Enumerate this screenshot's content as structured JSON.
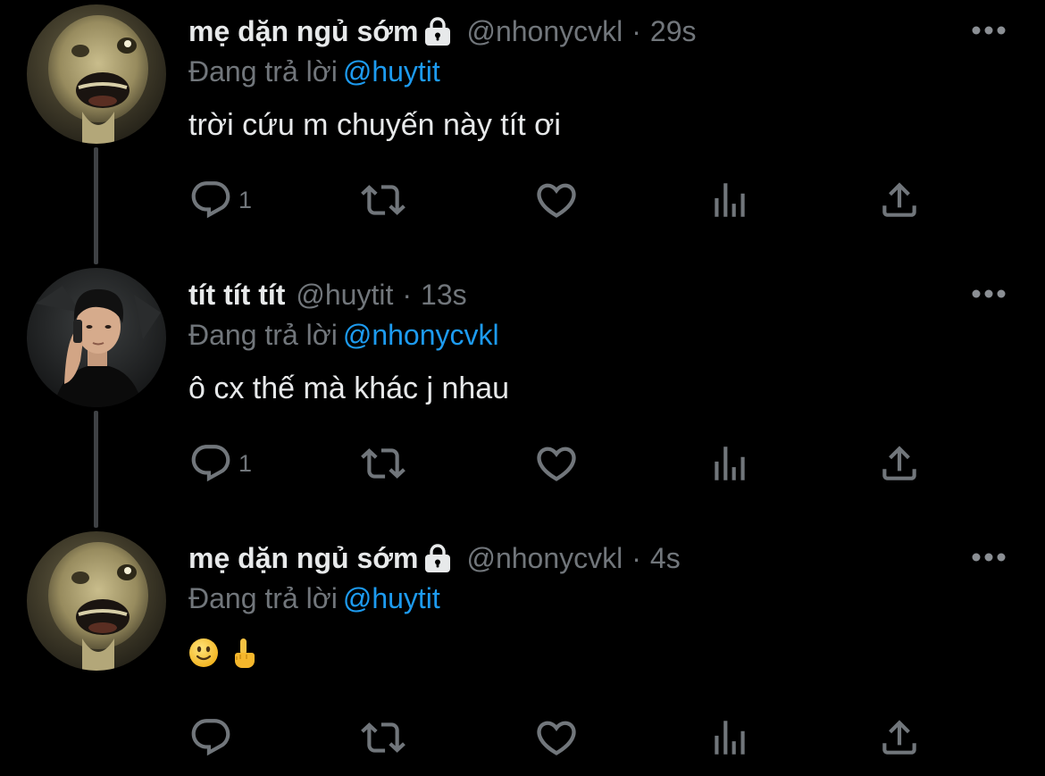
{
  "tweets": [
    {
      "display_name": "mẹ dặn ngủ sớm",
      "protected_icon": "lock-icon",
      "handle": "@nhonycvkl",
      "separator": "·",
      "time": "29s",
      "replying_to_label": "Đang trả lời",
      "replying_to_mention": "@huytit",
      "text": "trời cứu m chuyến này tít ơi",
      "reply_count": "1",
      "more_icon": "more-horizontal-icon",
      "avatar": "blurred-toy-face-avatar"
    },
    {
      "display_name": "tít tít tít",
      "handle": "@huytit",
      "separator": "·",
      "time": "13s",
      "replying_to_label": "Đang trả lời",
      "replying_to_mention": "@nhonycvkl",
      "text": "ô cx thế mà khác j nhau",
      "reply_count": "1",
      "more_icon": "more-horizontal-icon",
      "avatar": "person-on-phone-avatar"
    },
    {
      "display_name": "mẹ dặn ngủ sớm",
      "protected_icon": "lock-icon",
      "handle": "@nhonycvkl",
      "separator": "·",
      "time": "4s",
      "replying_to_label": "Đang trả lời",
      "replying_to_mention": "@huytit",
      "emojis": [
        "slightly-smiling-face-emoji",
        "middle-finger-emoji"
      ],
      "reply_count": "",
      "more_icon": "more-horizontal-icon",
      "avatar": "blurred-toy-face-avatar"
    }
  ],
  "action_icons": [
    "reply-icon",
    "retweet-icon",
    "like-icon",
    "views-icon",
    "share-icon"
  ],
  "colors": {
    "background": "#000000",
    "primary_text": "#e7e9ea",
    "secondary_text": "#71767b",
    "accent": "#1d9bf0",
    "thread_line": "#3e4144"
  }
}
